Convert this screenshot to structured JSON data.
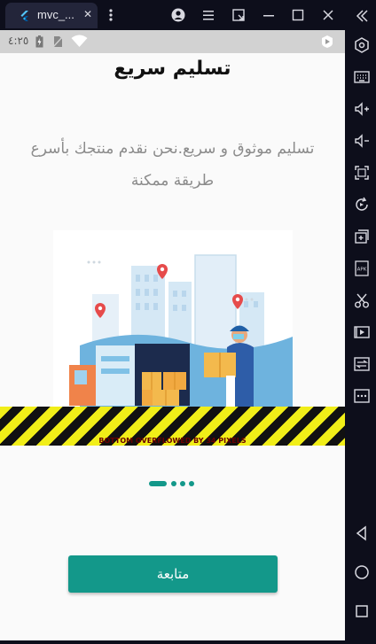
{
  "window": {
    "tab_title": "mvc_...",
    "close_glyph": "✕"
  },
  "status_bar": {
    "time": "٤:٢٥",
    "icons": [
      "battery-charging-icon",
      "sim-icon",
      "wifi-icon",
      "play-store-icon"
    ]
  },
  "onboarding": {
    "title": "تسليم سريع",
    "description": "تسليم موثوق و سريع.نحن نقدم منتجك بأسرع طريقة ممكنة",
    "overflow_warning": "BOTTOM OVERFLOWED BY 34 PIXELS",
    "page_indicator": {
      "count": 4,
      "current": 1
    },
    "next_button": "متابعة"
  },
  "colors": {
    "accent": "#13988a",
    "title_bar": "#0d0e1b",
    "status_bar": "#d2d2d2"
  },
  "sidebar_icons": [
    "back-double-chevron-icon",
    "settings-hex-icon",
    "keyboard-icon",
    "volume-up-icon",
    "volume-down-icon",
    "fullscreen-icon",
    "rotate-icon",
    "add-screen-icon",
    "apk-icon",
    "scissors-icon",
    "video-record-icon",
    "transfer-icon",
    "more-icon",
    "back-icon",
    "home-icon",
    "recents-icon"
  ]
}
